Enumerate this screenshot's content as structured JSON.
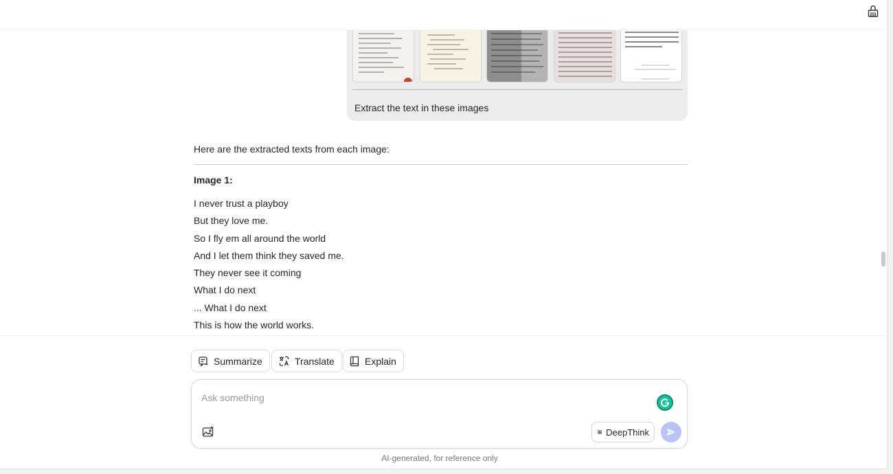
{
  "prompt": {
    "text": "Extract the text in these images",
    "attachments": [
      {
        "name": "handwritten-page-1"
      },
      {
        "name": "handwritten-page-2"
      },
      {
        "name": "handwritten-page-3"
      },
      {
        "name": "handwritten-page-4"
      },
      {
        "name": "handwritten-page-5"
      }
    ]
  },
  "response": {
    "intro": "Here are the extracted texts from each image:",
    "heading": "Image 1:",
    "lines": [
      "I never trust a playboy",
      "But they love me.",
      "So I fly em all around the world",
      "And I let them think they saved me.",
      "They never see it coming",
      "What I do next",
      "... What I do next",
      "This is how the world works."
    ]
  },
  "actions": {
    "summarize": "Summarize",
    "translate": "Translate",
    "explain": "Explain"
  },
  "composer": {
    "placeholder": "Ask something",
    "deepthink_label": "DeepThink"
  },
  "footer": {
    "disclaimer": "AI-generated, for reference only"
  },
  "colors": {
    "accent_send": "#b9c3f7",
    "grammarly": "#15c39a",
    "bubble_bg": "#ececec"
  }
}
